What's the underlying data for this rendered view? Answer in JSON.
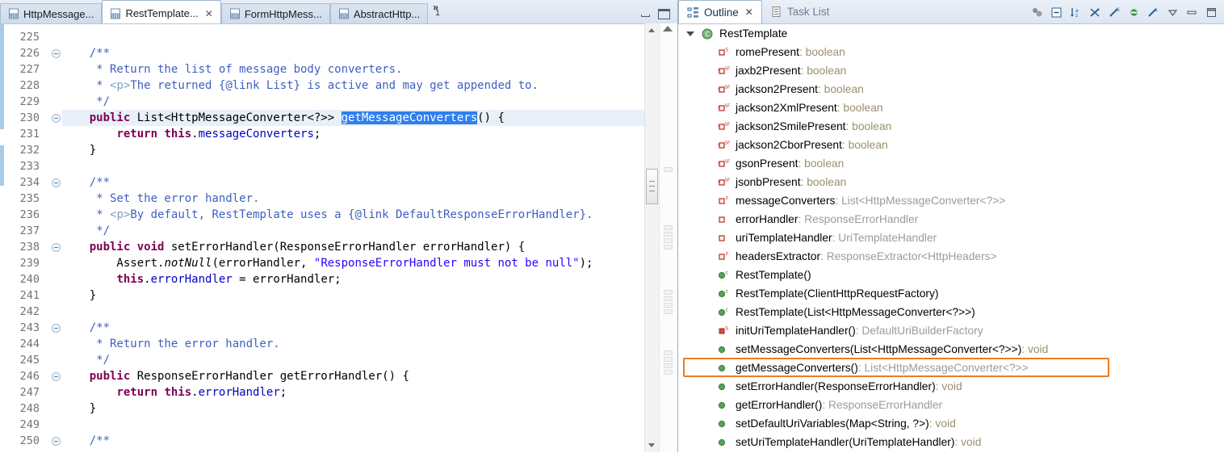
{
  "editor": {
    "tabs": [
      {
        "label": "HttpMessage...",
        "icon": "java-class-icon",
        "active": false,
        "closable": false
      },
      {
        "label": "RestTemplate...",
        "icon": "java-class-icon",
        "active": true,
        "closable": true
      },
      {
        "label": "FormHttpMess...",
        "icon": "java-class-icon",
        "active": false,
        "closable": false
      },
      {
        "label": "AbstractHttp...",
        "icon": "java-class-icon",
        "active": false,
        "closable": false
      }
    ],
    "overflow_indicator": "»",
    "overflow_count": "1",
    "window_buttons": [
      "minimize",
      "maximize"
    ],
    "highlighted_line": 230,
    "selection_text": "getMessageConverters",
    "selection_bg": "#2f7ff0",
    "highlight_line_bg": "#e8f0fa",
    "change_bar_color": "#a8cbe8",
    "first_line": 225,
    "lines": [
      {
        "n": 225,
        "fold": false,
        "tokens": []
      },
      {
        "n": 226,
        "fold": true,
        "tokens": [
          {
            "t": "    ",
            "c": "pl"
          },
          {
            "t": "/**",
            "c": "cm"
          }
        ]
      },
      {
        "n": 227,
        "fold": false,
        "tokens": [
          {
            "t": "     * Return the list of message body converters.",
            "c": "cm"
          }
        ]
      },
      {
        "n": 228,
        "fold": false,
        "tokens": [
          {
            "t": "     * ",
            "c": "cm"
          },
          {
            "t": "<p>",
            "c": "cmtag"
          },
          {
            "t": "The returned {@link List} is active and may get appended to.",
            "c": "cm"
          }
        ]
      },
      {
        "n": 229,
        "fold": false,
        "tokens": [
          {
            "t": "     */",
            "c": "cm"
          }
        ]
      },
      {
        "n": 230,
        "fold": true,
        "tokens": [
          {
            "t": "    ",
            "c": "pl"
          },
          {
            "t": "public",
            "c": "kw"
          },
          {
            "t": " List<HttpMessageConverter<?>> ",
            "c": "pl"
          },
          {
            "t": "getMessageConverters",
            "c": "sel"
          },
          {
            "t": "() {",
            "c": "pl"
          }
        ]
      },
      {
        "n": 231,
        "fold": false,
        "tokens": [
          {
            "t": "        ",
            "c": "pl"
          },
          {
            "t": "return",
            "c": "kw"
          },
          {
            "t": " ",
            "c": "pl"
          },
          {
            "t": "this",
            "c": "kw"
          },
          {
            "t": ".",
            "c": "pl"
          },
          {
            "t": "messageConverters",
            "c": "fld"
          },
          {
            "t": ";",
            "c": "pl"
          }
        ]
      },
      {
        "n": 232,
        "fold": false,
        "tokens": [
          {
            "t": "    }",
            "c": "pl"
          }
        ]
      },
      {
        "n": 233,
        "fold": false,
        "tokens": []
      },
      {
        "n": 234,
        "fold": true,
        "tokens": [
          {
            "t": "    ",
            "c": "pl"
          },
          {
            "t": "/**",
            "c": "cm"
          }
        ]
      },
      {
        "n": 235,
        "fold": false,
        "tokens": [
          {
            "t": "     * Set the error handler.",
            "c": "cm"
          }
        ]
      },
      {
        "n": 236,
        "fold": false,
        "tokens": [
          {
            "t": "     * ",
            "c": "cm"
          },
          {
            "t": "<p>",
            "c": "cmtag"
          },
          {
            "t": "By default, RestTemplate uses a {@link DefaultResponseErrorHandler}.",
            "c": "cm"
          }
        ]
      },
      {
        "n": 237,
        "fold": false,
        "tokens": [
          {
            "t": "     */",
            "c": "cm"
          }
        ]
      },
      {
        "n": 238,
        "fold": true,
        "tokens": [
          {
            "t": "    ",
            "c": "pl"
          },
          {
            "t": "public void",
            "c": "kw"
          },
          {
            "t": " setErrorHandler(ResponseErrorHandler errorHandler) {",
            "c": "pl"
          }
        ]
      },
      {
        "n": 239,
        "fold": false,
        "tokens": [
          {
            "t": "        Assert.",
            "c": "pl"
          },
          {
            "t": "notNull",
            "c": "sfn"
          },
          {
            "t": "(errorHandler, ",
            "c": "pl"
          },
          {
            "t": "\"ResponseErrorHandler must not be null\"",
            "c": "str"
          },
          {
            "t": ");",
            "c": "pl"
          }
        ]
      },
      {
        "n": 240,
        "fold": false,
        "tokens": [
          {
            "t": "        ",
            "c": "pl"
          },
          {
            "t": "this",
            "c": "kw"
          },
          {
            "t": ".",
            "c": "pl"
          },
          {
            "t": "errorHandler",
            "c": "fld"
          },
          {
            "t": " = errorHandler;",
            "c": "pl"
          }
        ]
      },
      {
        "n": 241,
        "fold": false,
        "tokens": [
          {
            "t": "    }",
            "c": "pl"
          }
        ]
      },
      {
        "n": 242,
        "fold": false,
        "tokens": []
      },
      {
        "n": 243,
        "fold": true,
        "tokens": [
          {
            "t": "    ",
            "c": "pl"
          },
          {
            "t": "/**",
            "c": "cm"
          }
        ]
      },
      {
        "n": 244,
        "fold": false,
        "tokens": [
          {
            "t": "     * Return the error handler.",
            "c": "cm"
          }
        ]
      },
      {
        "n": 245,
        "fold": false,
        "tokens": [
          {
            "t": "     */",
            "c": "cm"
          }
        ]
      },
      {
        "n": 246,
        "fold": true,
        "tokens": [
          {
            "t": "    ",
            "c": "pl"
          },
          {
            "t": "public",
            "c": "kw"
          },
          {
            "t": " ResponseErrorHandler getErrorHandler() {",
            "c": "pl"
          }
        ]
      },
      {
        "n": 247,
        "fold": false,
        "tokens": [
          {
            "t": "        ",
            "c": "pl"
          },
          {
            "t": "return",
            "c": "kw"
          },
          {
            "t": " ",
            "c": "pl"
          },
          {
            "t": "this",
            "c": "kw"
          },
          {
            "t": ".",
            "c": "pl"
          },
          {
            "t": "errorHandler",
            "c": "fld"
          },
          {
            "t": ";",
            "c": "pl"
          }
        ]
      },
      {
        "n": 248,
        "fold": false,
        "tokens": [
          {
            "t": "    }",
            "c": "pl"
          }
        ]
      },
      {
        "n": 249,
        "fold": false,
        "tokens": []
      },
      {
        "n": 250,
        "fold": true,
        "tokens": [
          {
            "t": "    ",
            "c": "pl"
          },
          {
            "t": "/**",
            "c": "cm"
          }
        ]
      }
    ]
  },
  "outline": {
    "tabs": [
      {
        "label": "Outline",
        "icon": "outline-icon",
        "active": true,
        "closable": true
      },
      {
        "label": "Task List",
        "icon": "tasklist-icon",
        "active": false,
        "closable": false
      }
    ],
    "toolbar": [
      {
        "name": "focus-on-active-task-icon"
      },
      {
        "name": "collapse-all-icon"
      },
      {
        "name": "sort-icon"
      },
      {
        "name": "hide-fields-icon"
      },
      {
        "name": "hide-static-icon"
      },
      {
        "name": "hide-non-public-icon"
      },
      {
        "name": "hide-local-types-icon"
      },
      {
        "name": "view-menu-icon"
      },
      {
        "name": "minimize-icon"
      },
      {
        "name": "maximize-icon"
      }
    ],
    "highlighted_item_index": 16,
    "highlight_border_color": "#ef7b20",
    "items": [
      {
        "name": "RestTemplate",
        "type": "",
        "icon": "class-icon",
        "depth": 0,
        "twisty": "open"
      },
      {
        "name": "romePresent",
        "type": "boolean",
        "icon": "field-private-static-icon",
        "depth": 1
      },
      {
        "name": "jaxb2Present",
        "type": "boolean",
        "icon": "field-private-static-final-icon",
        "depth": 1
      },
      {
        "name": "jackson2Present",
        "type": "boolean",
        "icon": "field-private-static-final-icon",
        "depth": 1
      },
      {
        "name": "jackson2XmlPresent",
        "type": "boolean",
        "icon": "field-private-static-final-icon",
        "depth": 1
      },
      {
        "name": "jackson2SmilePresent",
        "type": "boolean",
        "icon": "field-private-static-final-icon",
        "depth": 1
      },
      {
        "name": "jackson2CborPresent",
        "type": "boolean",
        "icon": "field-private-static-final-icon",
        "depth": 1
      },
      {
        "name": "gsonPresent",
        "type": "boolean",
        "icon": "field-private-static-final-icon",
        "depth": 1
      },
      {
        "name": "jsonbPresent",
        "type": "boolean",
        "icon": "field-private-static-final-icon",
        "depth": 1
      },
      {
        "name": "messageConverters",
        "type": "List<HttpMessageConverter<?>>",
        "icon": "field-private-final-icon",
        "depth": 1
      },
      {
        "name": "errorHandler",
        "type": "ResponseErrorHandler",
        "icon": "field-private-icon",
        "depth": 1
      },
      {
        "name": "uriTemplateHandler",
        "type": "UriTemplateHandler",
        "icon": "field-private-icon",
        "depth": 1
      },
      {
        "name": "headersExtractor",
        "type": "ResponseExtractor<HttpHeaders>",
        "icon": "field-private-final-icon",
        "depth": 1
      },
      {
        "name": "RestTemplate()",
        "type": "",
        "icon": "method-public-constructor-icon",
        "depth": 1
      },
      {
        "name": "RestTemplate(ClientHttpRequestFactory)",
        "type": "",
        "icon": "method-public-constructor-icon",
        "depth": 1
      },
      {
        "name": "RestTemplate(List<HttpMessageConverter<?>>)",
        "type": "",
        "icon": "method-public-constructor-icon",
        "depth": 1
      },
      {
        "name": "initUriTemplateHandler()",
        "type": "DefaultUriBuilderFactory",
        "icon": "method-private-static-icon",
        "depth": 1
      },
      {
        "name": "setMessageConverters(List<HttpMessageConverter<?>>)",
        "type": "void",
        "icon": "method-public-icon",
        "depth": 1
      },
      {
        "name": "getMessageConverters()",
        "type": "List<HttpMessageConverter<?>>",
        "icon": "method-public-icon",
        "depth": 1
      },
      {
        "name": "setErrorHandler(ResponseErrorHandler)",
        "type": "void",
        "icon": "method-public-icon",
        "depth": 1
      },
      {
        "name": "getErrorHandler()",
        "type": "ResponseErrorHandler",
        "icon": "method-public-icon",
        "depth": 1
      },
      {
        "name": "setDefaultUriVariables(Map<String, ?>)",
        "type": "void",
        "icon": "method-public-icon",
        "depth": 1
      },
      {
        "name": "setUriTemplateHandler(UriTemplateHandler)",
        "type": "void",
        "icon": "method-public-icon",
        "depth": 1
      }
    ]
  }
}
